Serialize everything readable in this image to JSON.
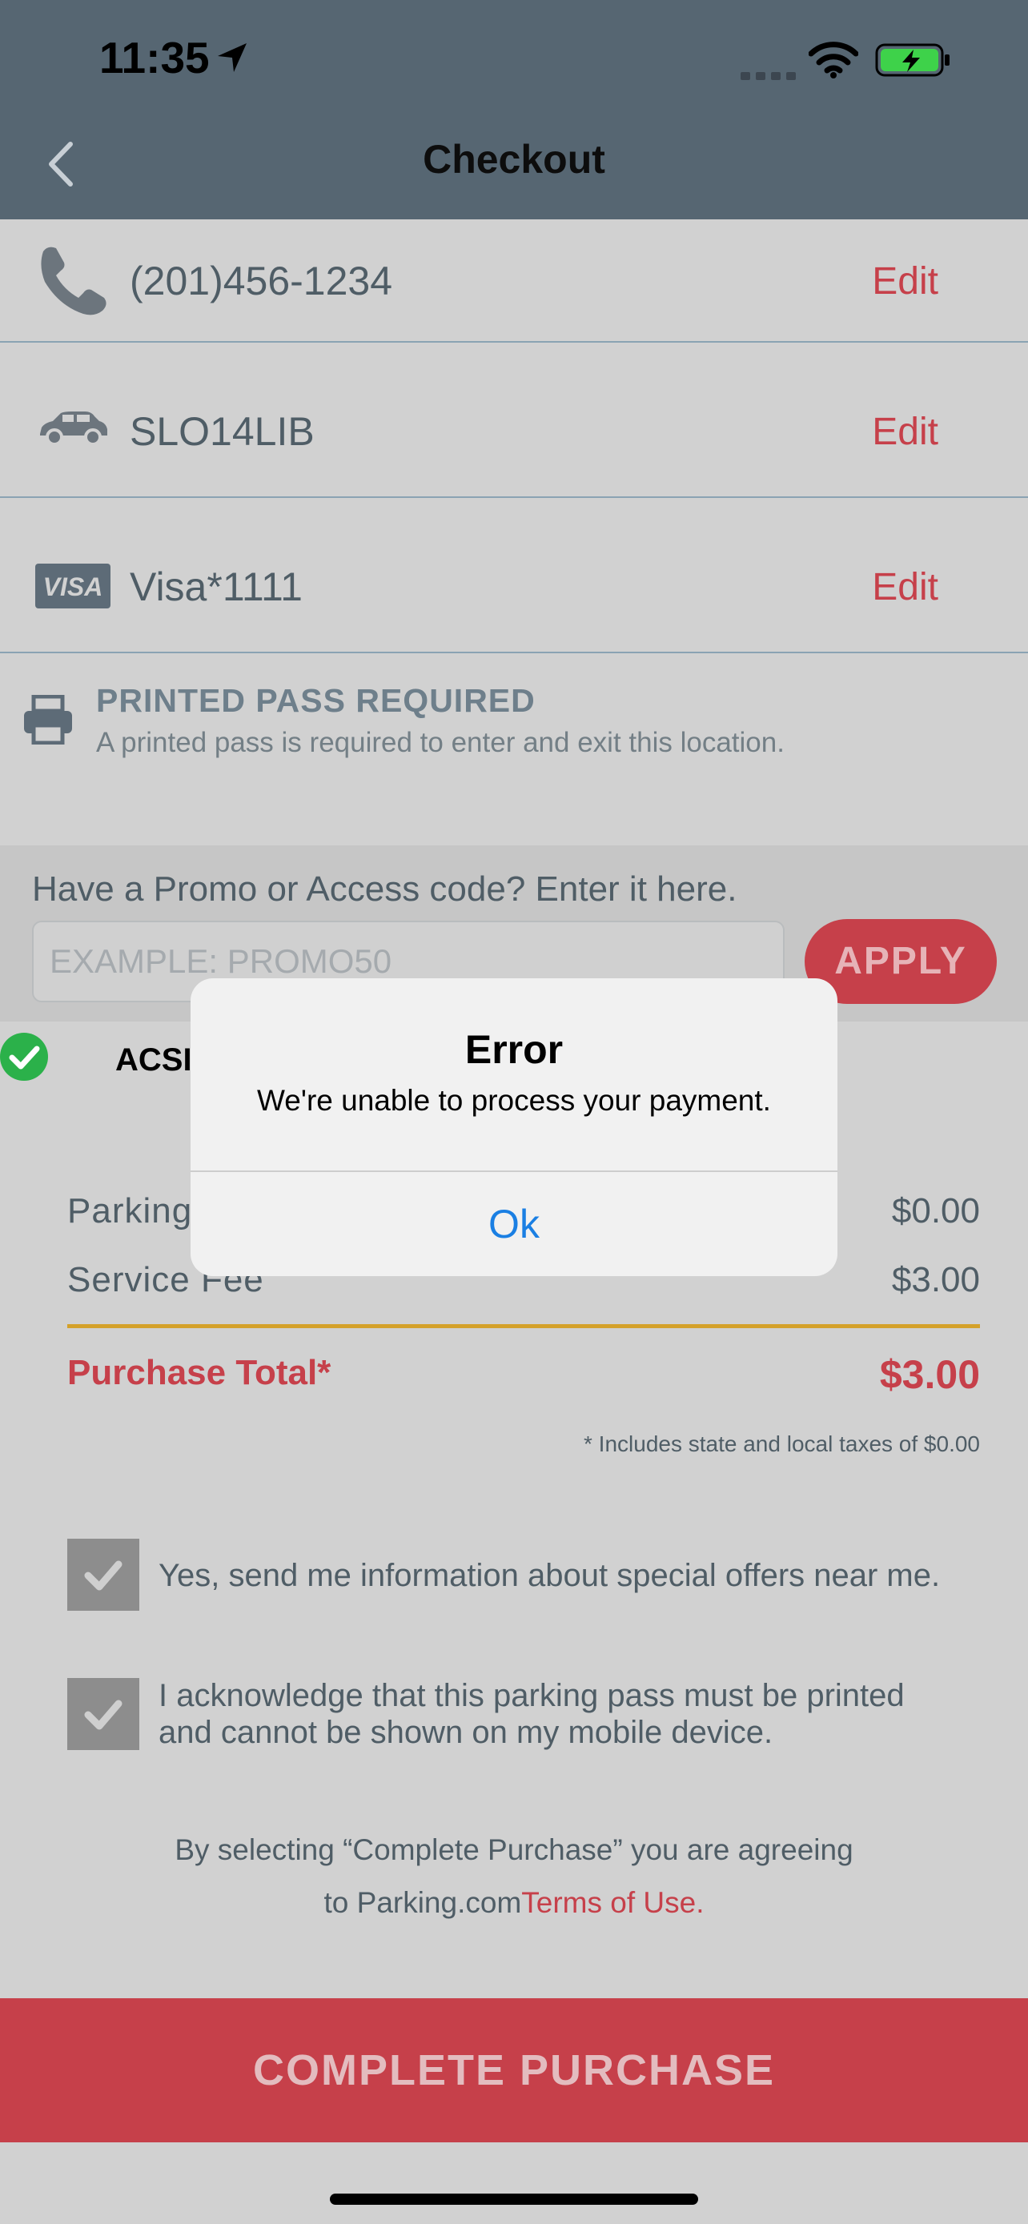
{
  "status_bar": {
    "time": "11:35"
  },
  "header": {
    "title": "Checkout"
  },
  "rows": [
    {
      "label": "(201)456-1234",
      "edit": "Edit",
      "icon": "phone-icon"
    },
    {
      "label": "SLO14LIB",
      "edit": "Edit",
      "icon": "car-icon"
    },
    {
      "label": "Visa*1111",
      "edit": "Edit",
      "icon": "visa-icon"
    }
  ],
  "printed_pass": {
    "title": "PRINTED PASS REQUIRED",
    "description": "A printed pass is required to enter and exit this location."
  },
  "promo": {
    "label": "Have a Promo or Access code? Enter it here.",
    "placeholder": "EXAMPLE: PROMO50",
    "apply": "APPLY",
    "applied_code": "ACSI"
  },
  "pricing": {
    "parking_label": "Parking",
    "parking_value": "$0.00",
    "service_label": "Service Fee",
    "service_value": "$3.00",
    "total_label": "Purchase Total*",
    "total_value": "$3.00",
    "tax_note": "* Includes state and local taxes of $0.00"
  },
  "options": {
    "offers": "Yes, send me information about special offers near me.",
    "acknowledge_line1": "I acknowledge that this parking pass must be printed",
    "acknowledge_line2": "and cannot be shown on my mobile device."
  },
  "terms": {
    "line1": "By selecting “Complete Purchase” you are agreeing",
    "line2_prefix": "to Parking.com",
    "link": "Terms of Use."
  },
  "complete_button": "COMPLETE PURCHASE",
  "dialog": {
    "title": "Error",
    "message": "We're unable to process your payment.",
    "ok": "Ok"
  },
  "colors": {
    "header": "#566672",
    "accent_red": "#c6404a",
    "divider_gold": "#d4a12a",
    "dialog_button": "#1a7fe3"
  }
}
